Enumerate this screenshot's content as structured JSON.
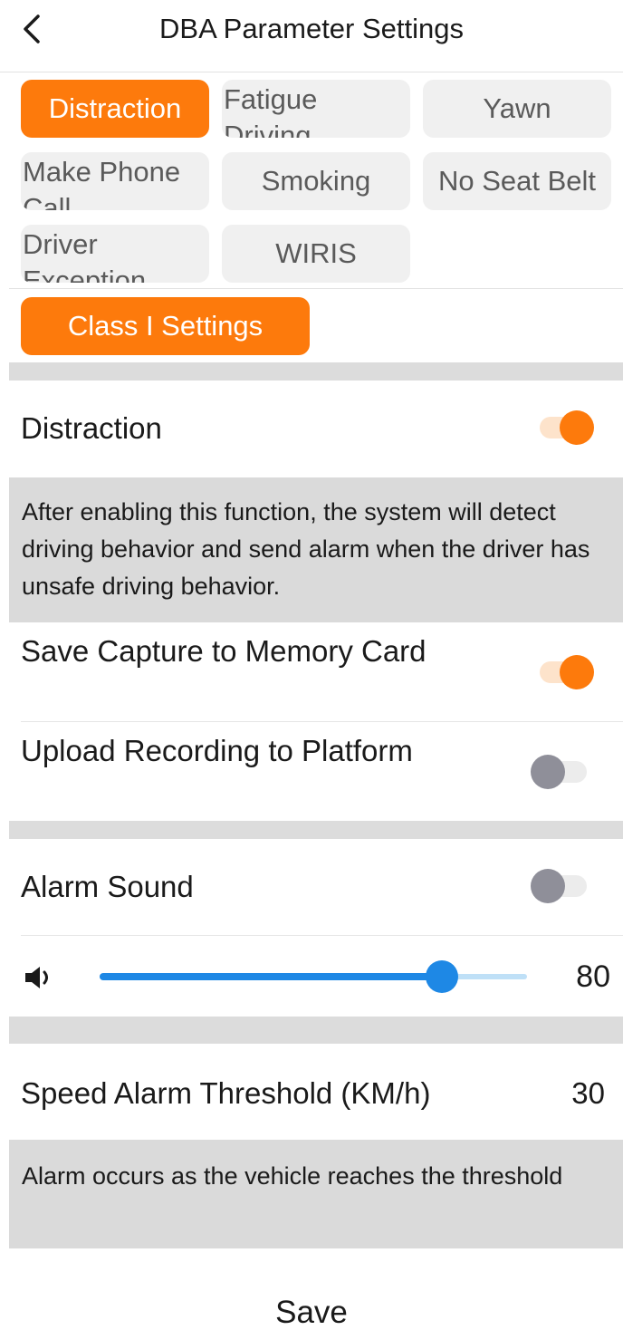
{
  "header": {
    "title": "DBA Parameter Settings",
    "back_icon": "chevron-left-icon"
  },
  "tabs": [
    {
      "label": "Distraction",
      "active": true
    },
    {
      "label": "Fatigue Driving",
      "active": false
    },
    {
      "label": "Yawn",
      "active": false
    },
    {
      "label": "Make Phone Call",
      "active": false
    },
    {
      "label": "Smoking",
      "active": false
    },
    {
      "label": "No Seat Belt",
      "active": false
    },
    {
      "label": "Driver Exception",
      "active": false
    },
    {
      "label": "WIRIS",
      "active": false
    }
  ],
  "class_button": {
    "label": "Class I Settings"
  },
  "settings": {
    "distraction": {
      "label": "Distraction",
      "enabled": true
    },
    "description": "After enabling this function, the system will detect driving behavior and send alarm when the driver has unsafe driving behavior.",
    "save_capture": {
      "label": "Save Capture to Memory Card",
      "enabled": true
    },
    "upload_recording": {
      "label": "Upload Recording to Platform",
      "enabled": false
    },
    "alarm_sound": {
      "label": "Alarm Sound",
      "enabled": false
    },
    "volume": {
      "icon": "volume-icon",
      "value": "80",
      "fraction": 0.8
    },
    "speed_threshold": {
      "label": "Speed Alarm Threshold (KM/h)",
      "value": "30"
    },
    "threshold_note": "Alarm occurs as the  vehicle reaches the threshold"
  },
  "footer": {
    "save_label": "Save"
  },
  "colors": {
    "accent": "#fd7a0c",
    "slider": "#1e88e5",
    "toggle_off_knob": "#8f8f99",
    "band": "#dcdcdc"
  }
}
